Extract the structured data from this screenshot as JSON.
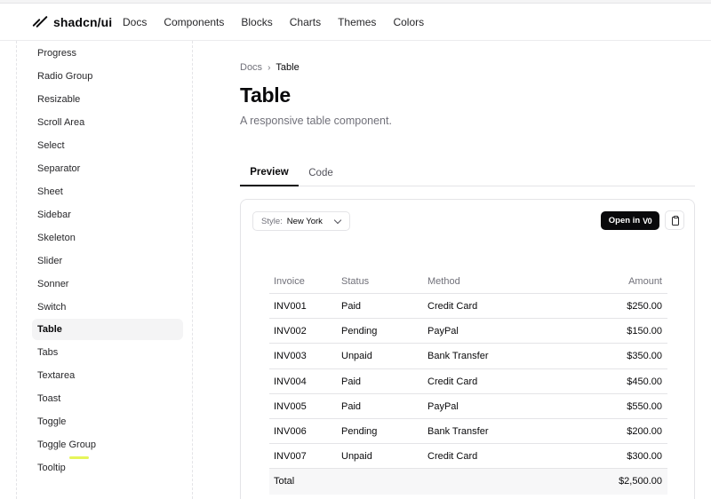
{
  "header": {
    "brand": "shadcn/ui",
    "nav": [
      "Docs",
      "Components",
      "Blocks",
      "Charts",
      "Themes",
      "Colors"
    ]
  },
  "sidebar": {
    "items": [
      "Progress",
      "Radio Group",
      "Resizable",
      "Scroll Area",
      "Select",
      "Separator",
      "Sheet",
      "Sidebar",
      "Skeleton",
      "Slider",
      "Sonner",
      "Switch",
      "Table",
      "Tabs",
      "Textarea",
      "Toast",
      "Toggle",
      "Toggle Group",
      "Tooltip"
    ],
    "active": "Table"
  },
  "breadcrumb": {
    "parent": "Docs",
    "separator": "›",
    "current": "Table"
  },
  "page": {
    "title": "Table",
    "description": "A responsive table component."
  },
  "tabs": [
    "Preview",
    "Code"
  ],
  "preview": {
    "style_label": "Style:",
    "style_value": "New York",
    "open_label": "Open in",
    "open_logo": "V0"
  },
  "table": {
    "headers": [
      "Invoice",
      "Status",
      "Method",
      "Amount"
    ],
    "rows": [
      [
        "INV001",
        "Paid",
        "Credit Card",
        "$250.00"
      ],
      [
        "INV002",
        "Pending",
        "PayPal",
        "$150.00"
      ],
      [
        "INV003",
        "Unpaid",
        "Bank Transfer",
        "$350.00"
      ],
      [
        "INV004",
        "Paid",
        "Credit Card",
        "$450.00"
      ],
      [
        "INV005",
        "Paid",
        "PayPal",
        "$550.00"
      ],
      [
        "INV006",
        "Pending",
        "Bank Transfer",
        "$200.00"
      ],
      [
        "INV007",
        "Unpaid",
        "Credit Card",
        "$300.00"
      ]
    ],
    "footer": [
      "Total",
      "$2,500.00"
    ]
  },
  "colors": {
    "text": "#09090b",
    "muted": "#71717a",
    "border": "#e4e4e7",
    "active_bg": "#f4f4f5"
  }
}
